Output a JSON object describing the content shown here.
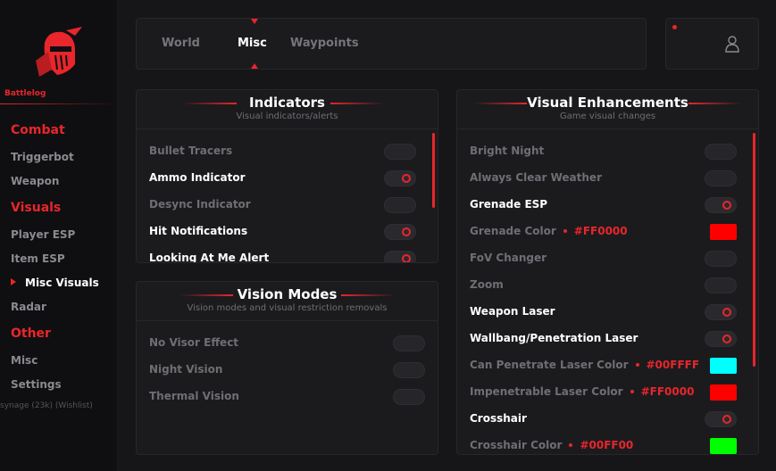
{
  "sidebar": {
    "brand": "Battlelog",
    "categories": {
      "combat": "Combat",
      "visuals": "Visuals",
      "other": "Other"
    },
    "items": {
      "triggerbot": "Triggerbot",
      "weapon": "Weapon",
      "player_esp": "Player ESP",
      "item_esp": "Item ESP",
      "misc_visuals": "Misc Visuals",
      "radar": "Radar",
      "misc": "Misc",
      "settings": "Settings"
    },
    "active_item": "Misc Visuals",
    "footer": "synage (23k) (Wishlist)"
  },
  "tabs": {
    "items": [
      "World",
      "Misc",
      "Waypoints"
    ],
    "active": "Misc"
  },
  "indicators": {
    "title": "Indicators",
    "subtitle": "Visual indicators/alerts",
    "rows": [
      {
        "label": "Bullet Tracers",
        "enabled": false
      },
      {
        "label": "Ammo Indicator",
        "enabled": true
      },
      {
        "label": "Desync Indicator",
        "enabled": false
      },
      {
        "label": "Hit Notifications",
        "enabled": true
      },
      {
        "label": "Looking At Me Alert",
        "enabled": true
      }
    ]
  },
  "vision_modes": {
    "title": "Vision Modes",
    "subtitle": "Vision modes and visual restriction removals",
    "rows": [
      {
        "label": "No Visor Effect",
        "enabled": false
      },
      {
        "label": "Night Vision",
        "enabled": false
      },
      {
        "label": "Thermal Vision",
        "enabled": false
      }
    ]
  },
  "visual_enhancements": {
    "title": "Visual Enhancements",
    "subtitle": "Game visual changes",
    "rows": [
      {
        "label": "Bright Night",
        "type": "toggle",
        "enabled": false
      },
      {
        "label": "Always Clear Weather",
        "type": "toggle",
        "enabled": false
      },
      {
        "label": "Grenade ESP",
        "type": "toggle",
        "enabled": true
      },
      {
        "label": "Grenade Color",
        "type": "color",
        "hex": "#FF0000",
        "color": "#ff0000"
      },
      {
        "label": "FoV Changer",
        "type": "toggle",
        "enabled": false
      },
      {
        "label": "Zoom",
        "type": "toggle",
        "enabled": false
      },
      {
        "label": "Weapon Laser",
        "type": "toggle",
        "enabled": true
      },
      {
        "label": "Wallbang/Penetration Laser",
        "type": "toggle",
        "enabled": true
      },
      {
        "label": "Can Penetrate Laser Color",
        "type": "color",
        "hex": "#00FFFF",
        "color": "#00ffff"
      },
      {
        "label": "Impenetrable Laser Color",
        "type": "color",
        "hex": "#FF0000",
        "color": "#ff0000"
      },
      {
        "label": "Crosshair",
        "type": "toggle",
        "enabled": true
      },
      {
        "label": "Crosshair Color",
        "type": "color",
        "hex": "#00FF00",
        "color": "#00ff00"
      }
    ]
  },
  "icons": {
    "logo": "knight-helmet-logo-icon",
    "user": "user-icon",
    "status": "status-dot-icon"
  },
  "colors": {
    "accent": "#e8262b",
    "background": "#161618",
    "panel": "#1b1b1e"
  }
}
